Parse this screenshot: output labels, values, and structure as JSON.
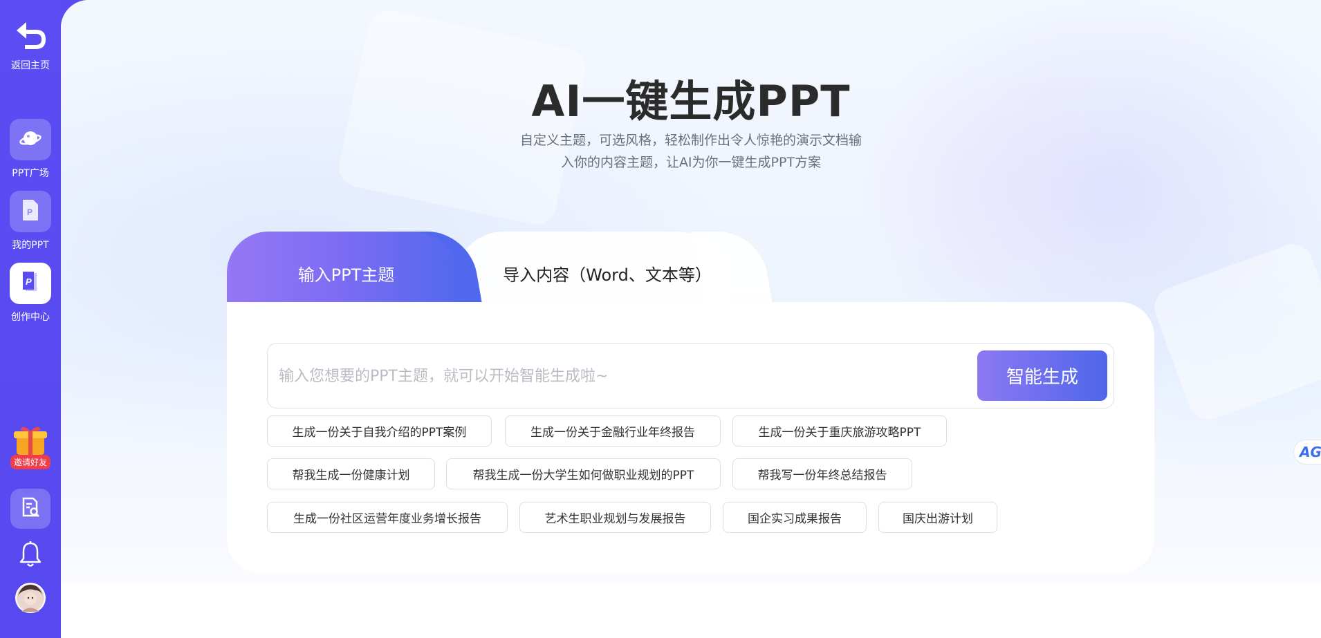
{
  "sidebar": {
    "back": {
      "label": "返回主页"
    },
    "items": [
      {
        "label": "PPT广场"
      },
      {
        "label": "我的PPT"
      },
      {
        "label": "创作中心"
      }
    ],
    "invite": {
      "label": "邀请好友"
    }
  },
  "main": {
    "title": "AI一键生成PPT",
    "subtitle_line1": "自定义主题，可选风格，轻松制作出令人惊艳的演示文档输",
    "subtitle_line2": "入你的内容主题，让AI为你一键生成PPT方案"
  },
  "tabs": [
    {
      "label": "输入PPT主题",
      "active": true
    },
    {
      "label": "导入内容（Word、文本等）",
      "active": false
    }
  ],
  "input": {
    "placeholder": "输入您想要的PPT主题，就可以开始智能生成啦~",
    "value": ""
  },
  "generate_button": {
    "label": "智能生成"
  },
  "suggestions": [
    "生成一份关于自我介绍的PPT案例",
    "生成一份关于金融行业年终报告",
    "生成一份关于重庆旅游攻略PPT",
    "帮我生成一份健康计划",
    "帮我生成一份大学生如何做职业规划的PPT",
    "帮我写一份年终总结报告",
    "生成一份社区运营年度业务增长报告",
    "艺术生职业规划与发展报告",
    "国企实习成果报告",
    "国庆出游计划"
  ],
  "float_badge": {
    "label": "AG"
  },
  "colors": {
    "sidebar": "#5a4cf2",
    "accent_start": "#9577f4",
    "accent_end": "#4f66ea"
  }
}
